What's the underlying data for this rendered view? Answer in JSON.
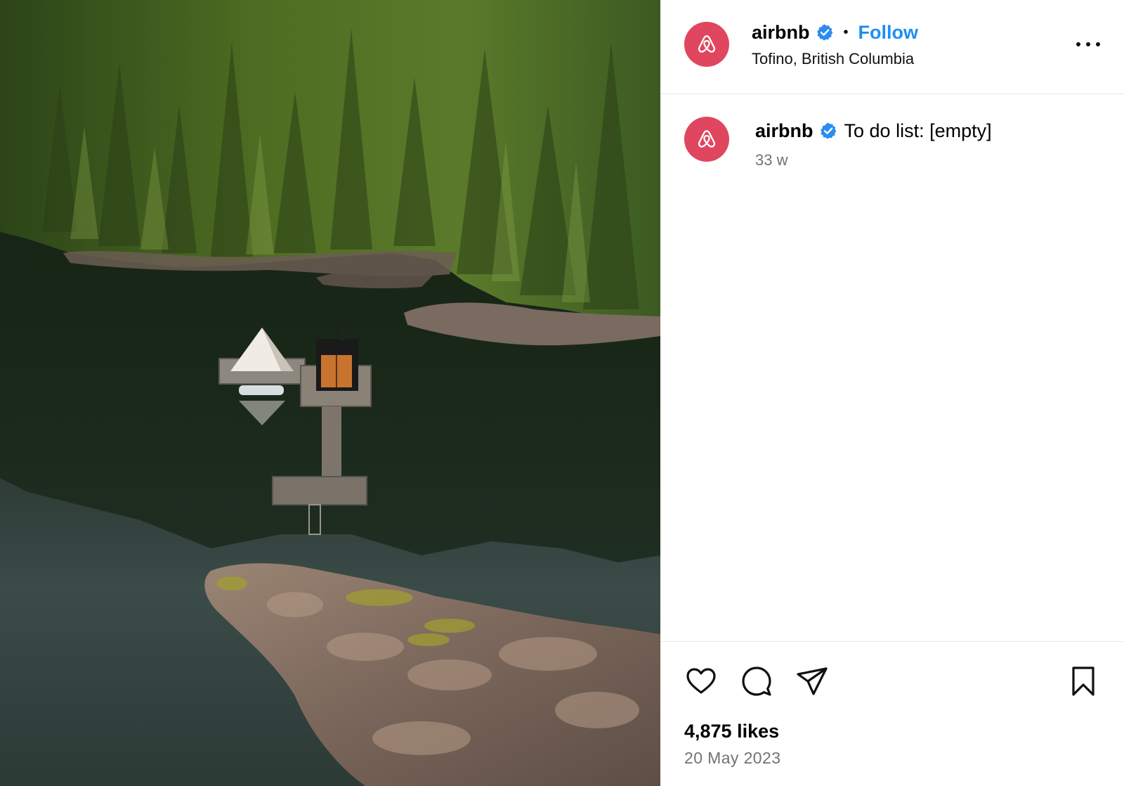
{
  "post": {
    "author": {
      "username": "airbnb",
      "verified": true,
      "location": "Tofino, British Columbia",
      "avatar_color": "#e0465f"
    },
    "header": {
      "separator": "•",
      "follow_label": "Follow",
      "follow_color": "#1f8ef1"
    },
    "caption": {
      "username": "airbnb",
      "text": "To do list: [empty]",
      "time_ago": "33 w"
    },
    "actions": {
      "icons": [
        "heart-icon",
        "comment-icon",
        "share-icon",
        "bookmark-icon"
      ]
    },
    "likes_label": "4,875 likes",
    "date": "20 May 2023",
    "image": {
      "subject": "aerial-forest-lake-floating-cabin",
      "colors": {
        "forest": "#3f5b23",
        "water": "#1e2b22",
        "rock": "#8a7466"
      }
    }
  }
}
